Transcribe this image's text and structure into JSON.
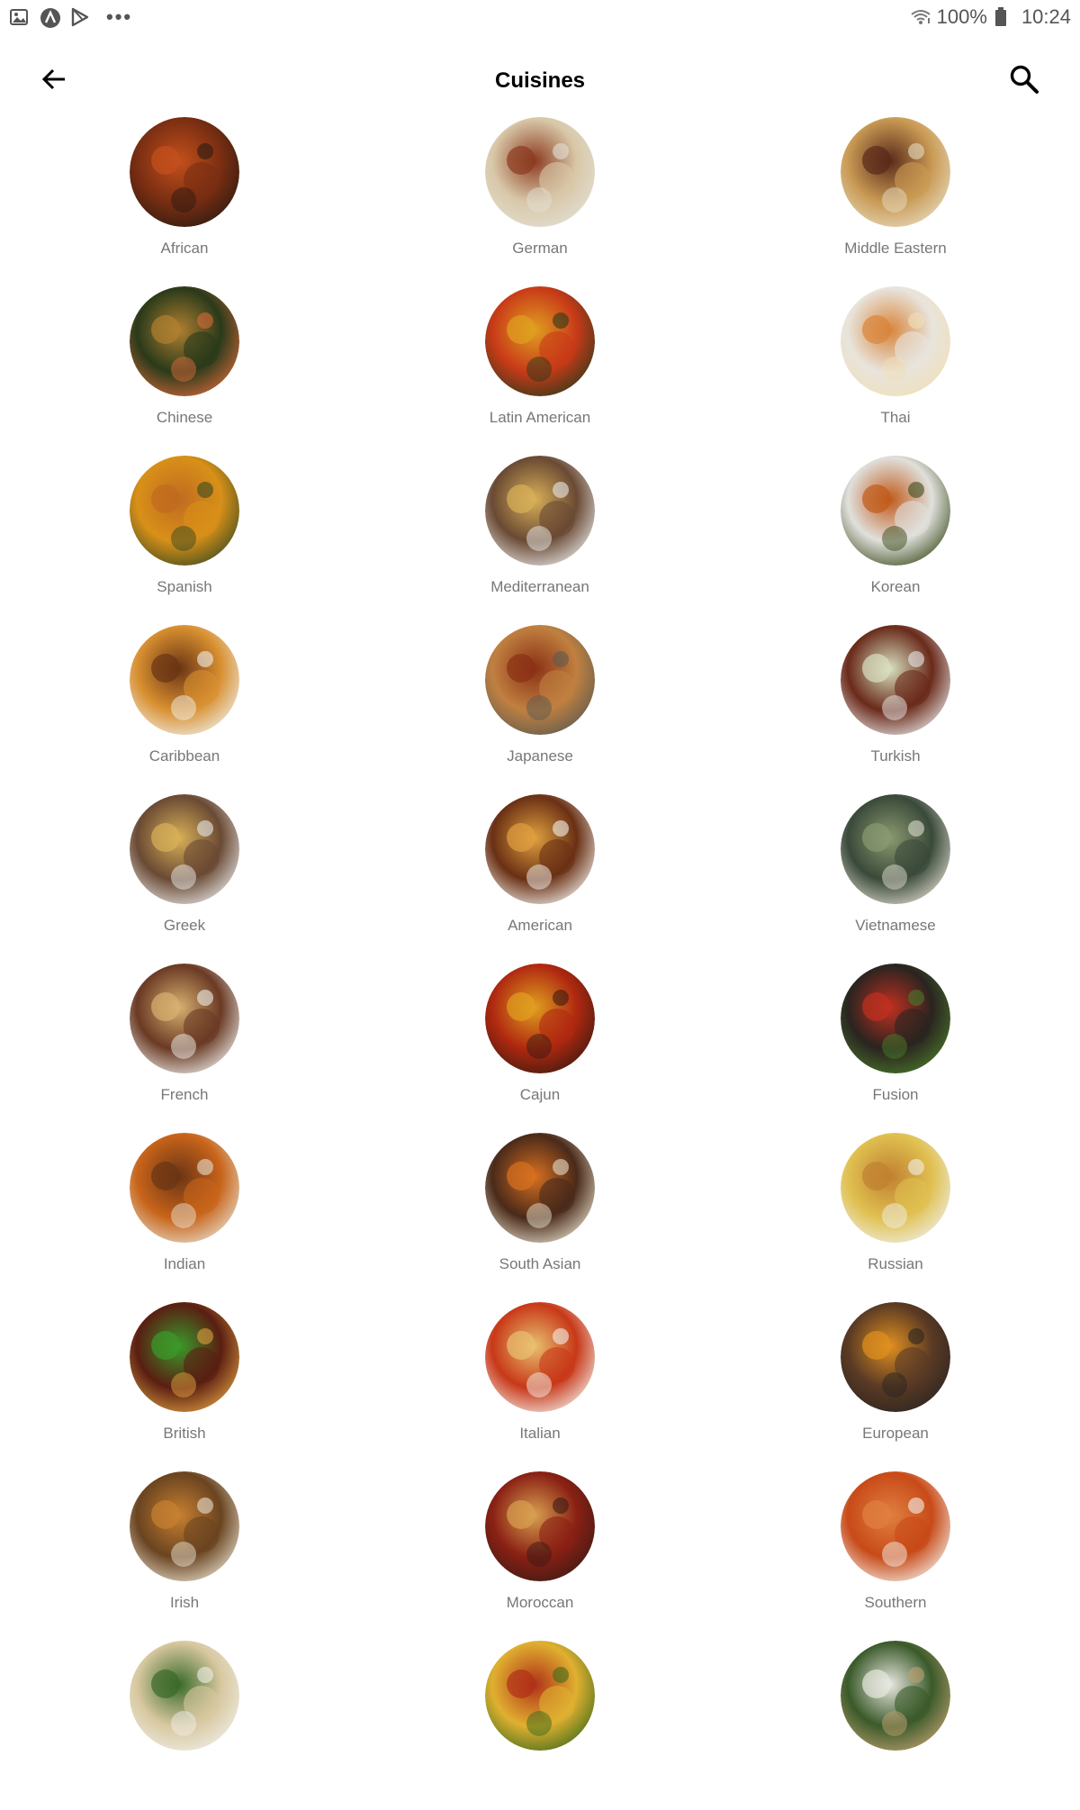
{
  "status_bar": {
    "battery": "100%",
    "time": "10:24",
    "more": "•••"
  },
  "app_bar": {
    "title": "Cuisines"
  },
  "cuisines": [
    {
      "label": "African",
      "c1": "#7a2e12",
      "c2": "#c4501c",
      "c3": "#2b1a12"
    },
    {
      "label": "German",
      "c1": "#d8c8a8",
      "c2": "#8c3a20",
      "c3": "#e3e0d6"
    },
    {
      "label": "Middle Eastern",
      "c1": "#c99a54",
      "c2": "#5a2a1a",
      "c3": "#e8dcc2"
    },
    {
      "label": "Chinese",
      "c1": "#2a3a1a",
      "c2": "#b08030",
      "c3": "#d86a3a"
    },
    {
      "label": "Latin American",
      "c1": "#c83a18",
      "c2": "#e0a020",
      "c3": "#2a3a1a"
    },
    {
      "label": "Thai",
      "c1": "#e8e4dc",
      "c2": "#d8843a",
      "c3": "#f0e0b8"
    },
    {
      "label": "Spanish",
      "c1": "#d89018",
      "c2": "#c06a20",
      "c3": "#3a4a20"
    },
    {
      "label": "Mediterranean",
      "c1": "#6a4a34",
      "c2": "#d8b058",
      "c3": "#eaeaea"
    },
    {
      "label": "Korean",
      "c1": "#e0e0dc",
      "c2": "#c05a1a",
      "c3": "#3a4a1a"
    },
    {
      "label": "Caribbean",
      "c1": "#d89030",
      "c2": "#6a3414",
      "c3": "#f0f0ec"
    },
    {
      "label": "Japanese",
      "c1": "#c08040",
      "c2": "#8a3014",
      "c3": "#5c5a50"
    },
    {
      "label": "Turkish",
      "c1": "#6a2a1a",
      "c2": "#d8e0c0",
      "c3": "#eaeaea"
    },
    {
      "label": "Greek",
      "c1": "#6a4a34",
      "c2": "#d8b058",
      "c3": "#eaeaea"
    },
    {
      "label": "American",
      "c1": "#6a3014",
      "c2": "#e0a040",
      "c3": "#f4f4f0"
    },
    {
      "label": "Vietnamese",
      "c1": "#3a4a3a",
      "c2": "#8a9a70",
      "c3": "#e0dcd0"
    },
    {
      "label": "French",
      "c1": "#6a3a24",
      "c2": "#d8b070",
      "c3": "#f0f0ec"
    },
    {
      "label": "Cajun",
      "c1": "#b02810",
      "c2": "#e0a020",
      "c3": "#3a1a10"
    },
    {
      "label": "Fusion",
      "c1": "#2a2420",
      "c2": "#c03020",
      "c3": "#4a7a2a"
    },
    {
      "label": "Indian",
      "c1": "#c8641a",
      "c2": "#6a3414",
      "c3": "#e8e0d0"
    },
    {
      "label": "South Asian",
      "c1": "#4a2a1a",
      "c2": "#d87020",
      "c3": "#e8e0cc"
    },
    {
      "label": "Russian",
      "c1": "#e0c050",
      "c2": "#c08030",
      "c3": "#f0f0ea"
    },
    {
      "label": "British",
      "c1": "#5a1e12",
      "c2": "#3a9a2a",
      "c3": "#e0a040"
    },
    {
      "label": "Italian",
      "c1": "#c83818",
      "c2": "#e8c070",
      "c3": "#f4f0ea"
    },
    {
      "label": "European",
      "c1": "#5a3a24",
      "c2": "#e09020",
      "c3": "#2a2420"
    },
    {
      "label": "Irish",
      "c1": "#6a4420",
      "c2": "#c88030",
      "c3": "#e8e0d0"
    },
    {
      "label": "Moroccan",
      "c1": "#8a2014",
      "c2": "#d8a050",
      "c3": "#3a1a14"
    },
    {
      "label": "Southern",
      "c1": "#c84a18",
      "c2": "#e08040",
      "c3": "#f4f0ea"
    },
    {
      "label": "",
      "c1": "#d8c8a0",
      "c2": "#3a6a2a",
      "c3": "#f0eee8"
    },
    {
      "label": "",
      "c1": "#e0b030",
      "c2": "#b03018",
      "c3": "#3a6a1a"
    },
    {
      "label": "",
      "c1": "#3a5a2a",
      "c2": "#e8e8e0",
      "c3": "#c0a070"
    }
  ]
}
